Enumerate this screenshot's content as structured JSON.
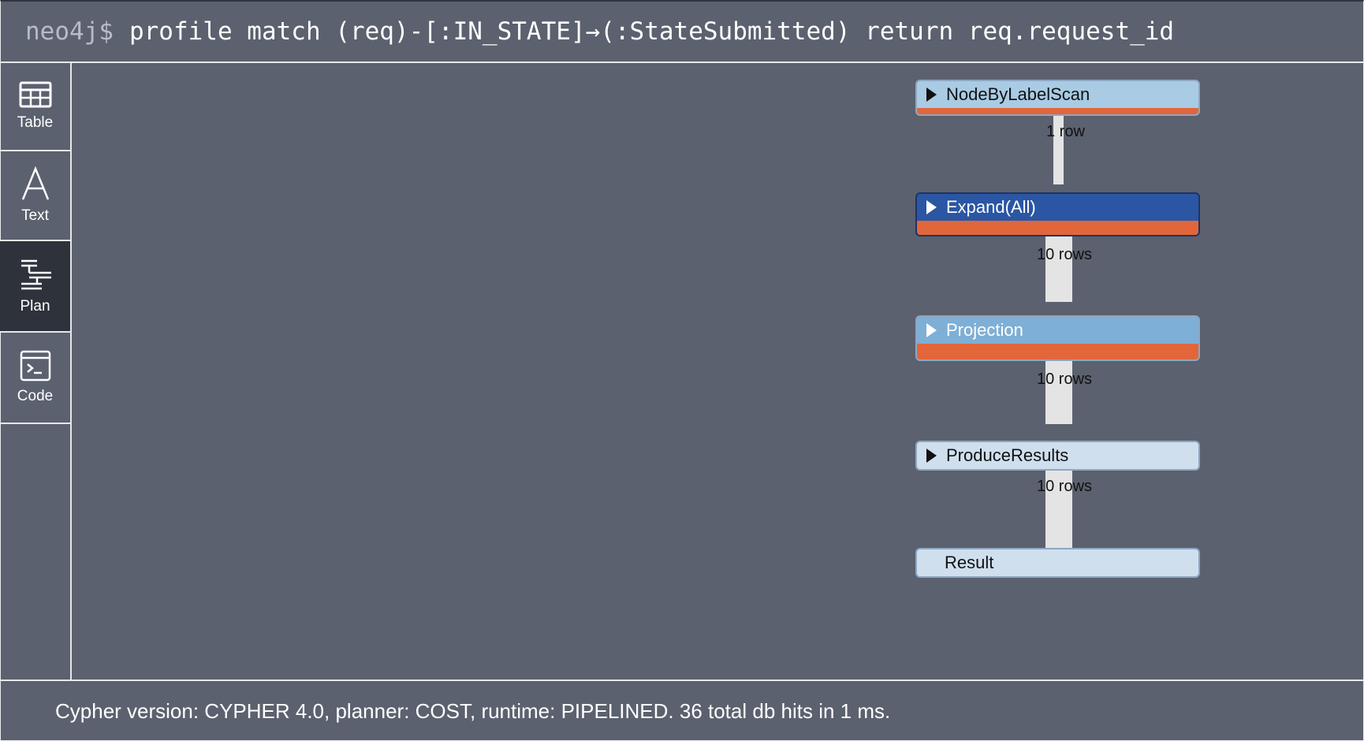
{
  "command": {
    "prompt": "neo4j$",
    "query": "profile match (req)-[:IN_STATE]→(:StateSubmitted) return req.request_id"
  },
  "sidebar": {
    "items": [
      {
        "label": "Table",
        "icon": "table-icon"
      },
      {
        "label": "Text",
        "icon": "text-icon"
      },
      {
        "label": "Plan",
        "icon": "plan-icon",
        "active": true
      },
      {
        "label": "Code",
        "icon": "code-icon"
      }
    ]
  },
  "plan": {
    "operators": [
      {
        "name": "NodeByLabelScan",
        "color": "#a9cbe4",
        "text_color": "#111111"
      },
      {
        "name": "Expand(All)",
        "color": "#2a56a3",
        "text_color": "#ffffff"
      },
      {
        "name": "Projection",
        "color": "#7eafd6",
        "text_color": "#ffffff"
      },
      {
        "name": "ProduceResults",
        "color": "#cfdfee",
        "text_color": "#111111"
      },
      {
        "name": "Result",
        "color": "#cfdfee",
        "text_color": "#111111"
      }
    ],
    "edges": [
      {
        "label": "1 row",
        "rows": 1
      },
      {
        "label": "10 rows",
        "rows": 10
      },
      {
        "label": "10 rows",
        "rows": 10
      },
      {
        "label": "10 rows",
        "rows": 10
      }
    ],
    "db_hit_color": "#e2663a"
  },
  "footer": {
    "text": "Cypher version: CYPHER 4.0, planner: COST, runtime: PIPELINED. 36 total db hits in 1 ms."
  }
}
